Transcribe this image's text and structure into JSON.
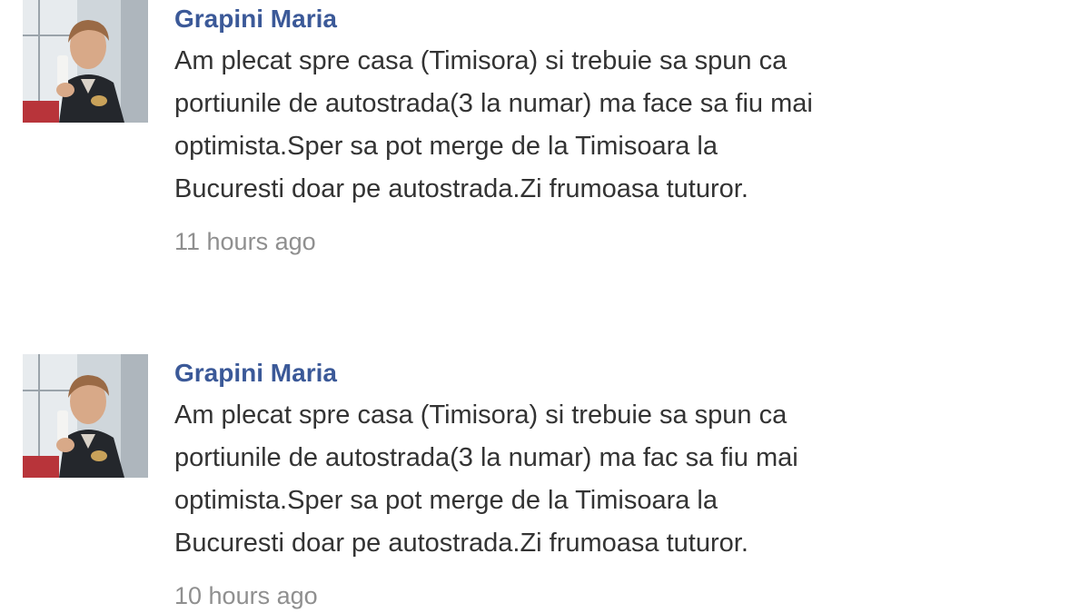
{
  "posts": [
    {
      "author": "Grapini Maria",
      "avatar_icon": "profile-photo",
      "lines": [
        "Am plecat spre casa (Timisora) si trebuie sa spun ca",
        "portiunile de autostrada(3 la numar) ma face sa fiu mai",
        "optimista.Sper sa pot merge de la Timisoara la",
        "Bucuresti doar pe autostrada.Zi frumoasa tuturor."
      ],
      "timestamp": "11 hours ago"
    },
    {
      "author": "Grapini Maria",
      "avatar_icon": "profile-photo",
      "lines": [
        "Am plecat spre casa (Timisora) si trebuie sa spun ca",
        "portiunile de autostrada(3 la numar) ma fac sa fiu mai",
        "optimista.Sper sa pot merge de la Timisoara la",
        "Bucuresti doar pe autostrada.Zi frumoasa tuturor."
      ],
      "timestamp": "10 hours ago"
    }
  ],
  "colors": {
    "author": "#3b5998",
    "text": "#333333",
    "timestamp": "#8f8f8f"
  }
}
